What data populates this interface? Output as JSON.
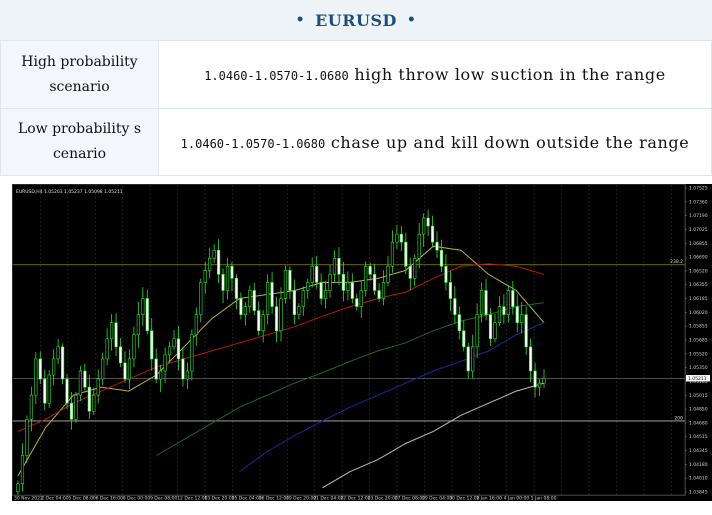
{
  "header": {
    "symbol": "EURUSD",
    "bullet": "•"
  },
  "scenarios": [
    {
      "label_line1": "High probability",
      "label_line2": "scenario",
      "range": "1.0460-1.0570-1.0680",
      "description": "high throw low suction in the range"
    },
    {
      "label_line1": "Low probability s",
      "label_line2": "cenario",
      "range": "1.0460-1.0570-1.0680",
      "description": "chase up and kill down outside the range"
    }
  ],
  "chart_data": {
    "type": "candlestick",
    "symbol_info": "EURUSD,H4  1.05203 1.05237 1.05098 1.05211",
    "y_ticks": [
      "1.07525",
      "1.07360",
      "1.07190",
      "1.07025",
      "1.06855",
      "1.06690",
      "1.06520",
      "1.06355",
      "1.06185",
      "1.06020",
      "1.05855",
      "1.05685",
      "1.05520",
      "1.05350",
      "1.05185",
      "1.05015",
      "1.04850",
      "1.04680",
      "1.04515",
      "1.04345",
      "1.04180",
      "1.04010",
      "1.03845"
    ],
    "ylim": [
      1.0376,
      1.0761
    ],
    "x_ticks": [
      "30 Nov 2022",
      "2 Dec 04:00",
      "5 Dec 08:00",
      "6 Dec 16:00",
      "8 Dec 00:00",
      "9 Dec 08:00",
      "12 Dec 12:00",
      "13 Dec 20:00",
      "15 Dec 04:00",
      "16 Dec 12:00",
      "19 Dec 20:00",
      "21 Dec 04:00",
      "22 Dec 12:00",
      "23 Dec 20:00",
      "27 Dec 08:00",
      "29 Dec 04:00",
      "30 Dec 12:00",
      "2 Jan 16:00",
      "4 Jan 00:00",
      "5 Jan 08:00"
    ],
    "current_price": "1.05211",
    "hlines": [
      {
        "label": "238.2",
        "value": 1.0662,
        "color": "#8a8a00"
      },
      {
        "label": "200",
        "value": 1.0468,
        "color": "#b5b5b5"
      }
    ],
    "current_line_value": 1.0521,
    "closes": [
      1.039,
      1.0425,
      1.047,
      1.05,
      1.0545,
      1.052,
      1.049,
      1.0525,
      1.0545,
      1.056,
      1.052,
      1.049,
      1.047,
      1.05,
      1.053,
      1.051,
      1.048,
      1.05,
      1.052,
      1.0545,
      1.057,
      1.059,
      1.056,
      1.054,
      1.052,
      1.0545,
      1.0575,
      1.06,
      1.062,
      1.058,
      1.0545,
      1.052,
      1.053,
      1.055,
      1.056,
      1.057,
      1.0545,
      1.052,
      1.053,
      1.0575,
      1.06,
      1.064,
      1.0655,
      1.067,
      1.068,
      1.065,
      1.063,
      1.066,
      1.0645,
      1.062,
      1.06,
      1.061,
      1.063,
      1.0605,
      1.058,
      1.06,
      1.064,
      1.061,
      1.058,
      1.062,
      1.0655,
      1.063,
      1.06,
      1.061,
      1.063,
      1.064,
      1.066,
      1.064,
      1.062,
      1.063,
      1.065,
      1.067,
      1.065,
      1.063,
      1.064,
      1.062,
      1.061,
      1.063,
      1.066,
      1.065,
      1.063,
      1.062,
      1.064,
      1.066,
      1.069,
      1.07,
      1.069,
      1.066,
      1.0645,
      1.067,
      1.07,
      1.072,
      1.071,
      1.069,
      1.068,
      1.066,
      1.064,
      1.062,
      1.06,
      1.058,
      1.056,
      1.053,
      1.056,
      1.06,
      1.063,
      1.06,
      1.057,
      1.059,
      1.061,
      1.06,
      1.063,
      1.061,
      1.059,
      1.06,
      1.056,
      1.053,
      1.051,
      1.0515,
      1.0521
    ],
    "ma_lines": [
      {
        "name": "MA fast",
        "color": "#b8b04a",
        "values": [
          1.04,
          1.046,
          1.05,
          1.051,
          1.0505,
          1.0525,
          1.056,
          1.0595,
          1.062,
          1.0625,
          1.063,
          1.064,
          1.064,
          1.0645,
          1.0655,
          1.0685,
          1.068,
          1.065,
          1.063,
          1.059
        ]
      },
      {
        "name": "MA red",
        "color": "#b01818",
        "values": [
          1.0455,
          1.047,
          1.049,
          1.0505,
          1.052,
          1.0535,
          1.0545,
          1.0555,
          1.0565,
          1.0575,
          1.0585,
          1.0598,
          1.061,
          1.062,
          1.0628,
          1.0645,
          1.066,
          1.0663,
          1.066,
          1.065
        ]
      },
      {
        "name": "MA green",
        "color": "#1e6a1e",
        "values": [
          null,
          null,
          null,
          null,
          null,
          1.0425,
          1.0445,
          1.0465,
          1.0485,
          1.05,
          1.0515,
          1.0528,
          1.0542,
          1.0555,
          1.0565,
          1.058,
          1.0592,
          1.06,
          1.061,
          1.0615
        ]
      },
      {
        "name": "MA blue",
        "color": "#1a2a9a",
        "values": [
          null,
          null,
          null,
          null,
          null,
          null,
          null,
          null,
          1.0405,
          1.043,
          1.045,
          1.0468,
          1.0485,
          1.05,
          1.0515,
          1.053,
          1.0542,
          1.0555,
          1.0575,
          1.059
        ]
      },
      {
        "name": "MA white",
        "color": "#bdbdbd",
        "values": [
          null,
          null,
          null,
          null,
          null,
          null,
          null,
          null,
          null,
          null,
          null,
          1.0385,
          1.0405,
          1.042,
          1.044,
          1.0455,
          1.0475,
          1.049,
          1.0505,
          1.0515
        ]
      }
    ]
  }
}
